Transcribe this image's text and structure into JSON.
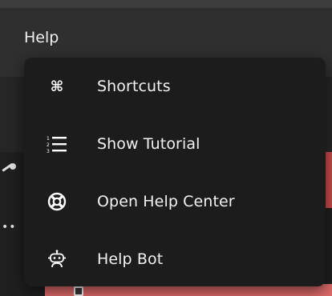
{
  "menubar": {
    "help_label": "Help"
  },
  "help_menu": {
    "items": [
      {
        "label": "Shortcuts",
        "icon": "command-key-icon"
      },
      {
        "label": "Show Tutorial",
        "icon": "numbered-list-icon"
      },
      {
        "label": "Open Help Center",
        "icon": "lifebuoy-icon"
      },
      {
        "label": "Help Bot",
        "icon": "robot-icon"
      }
    ]
  },
  "colors": {
    "menu_background": "#1c1c1c",
    "menu_text": "#f2f2f2",
    "app_background": "#2b2b2b",
    "accent_red": "#c94a4a"
  }
}
